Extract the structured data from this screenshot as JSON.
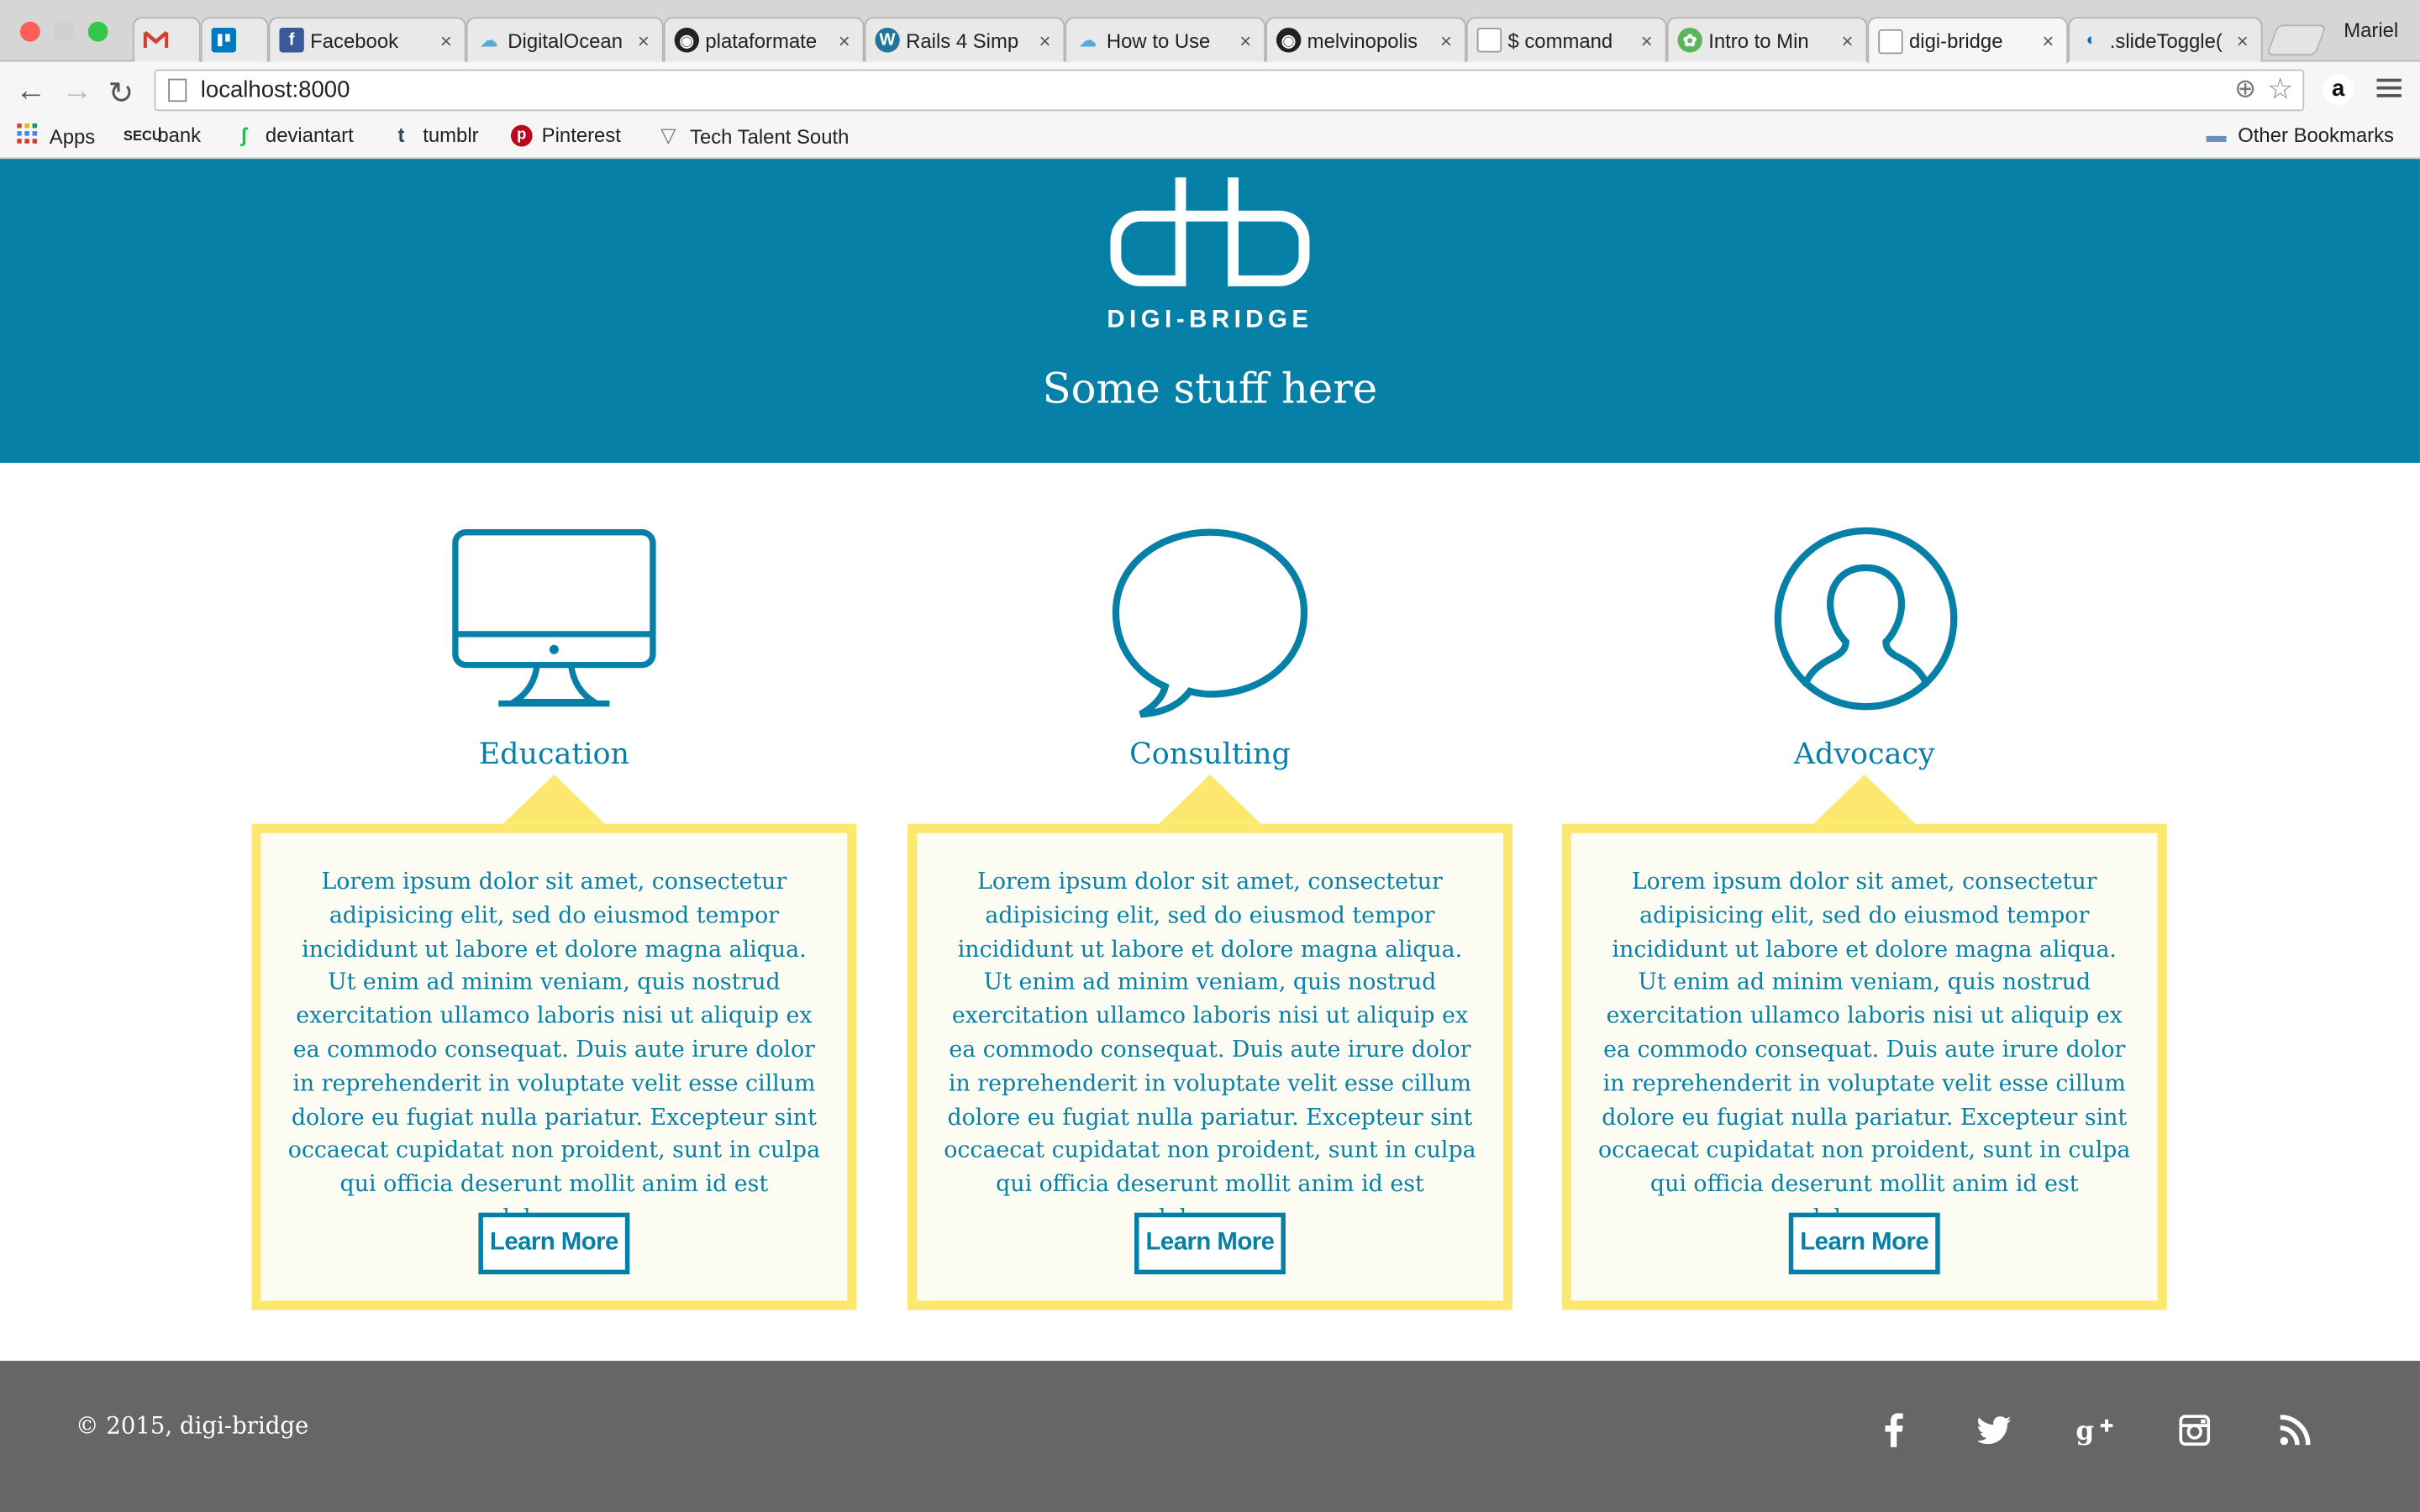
{
  "browser": {
    "profile_name": "Mariel",
    "tabs": [
      {
        "title": "",
        "icon": "gmail-icon"
      },
      {
        "title": "",
        "icon": "trello-icon"
      },
      {
        "title": "Facebook",
        "icon": "facebook-icon"
      },
      {
        "title": "DigitalOcean",
        "icon": "digitalocean-icon"
      },
      {
        "title": "plataformate",
        "icon": "github-icon"
      },
      {
        "title": "Rails 4 Simp",
        "icon": "wordpress-icon"
      },
      {
        "title": "How to Use",
        "icon": "cloud-icon"
      },
      {
        "title": "melvinopolis",
        "icon": "github-icon"
      },
      {
        "title": "$ command",
        "icon": "page-icon"
      },
      {
        "title": "Intro to Min",
        "icon": "leaf-icon"
      },
      {
        "title": "digi-bridge",
        "icon": "page-icon",
        "active": true
      },
      {
        "title": ".slideToggle(",
        "icon": "jquery-icon"
      }
    ],
    "url": "localhost:8000",
    "bookmarks": [
      {
        "label": "Apps",
        "icon": "apps-grid-icon"
      },
      {
        "label": "bank",
        "icon": "bank-icon"
      },
      {
        "label": "deviantart",
        "icon": "deviantart-icon"
      },
      {
        "label": "tumblr",
        "icon": "tumblr-icon"
      },
      {
        "label": "Pinterest",
        "icon": "pinterest-icon"
      },
      {
        "label": "Tech Talent South",
        "icon": "triangle-icon"
      }
    ],
    "other_bookmarks": "Other Bookmarks"
  },
  "hero": {
    "brand": "DIGI-BRIDGE",
    "tagline": "Some stuff here",
    "background_color": "#0780a7"
  },
  "services": [
    {
      "title": "Education",
      "icon": "monitor-icon",
      "text": "Lorem ipsum dolor sit amet, consectetur adipisicing elit, sed do eiusmod tempor incididunt ut labore et dolore magna aliqua. Ut enim ad minim veniam, quis nostrud exercitation ullamco laboris nisi ut aliquip ex ea commodo consequat. Duis aute irure dolor in reprehenderit in voluptate velit esse cillum dolore eu fugiat nulla pariatur. Excepteur sint occaecat cupidatat non proident, sunt in culpa qui officia deserunt mollit anim id est laborum.",
      "button": "Learn More"
    },
    {
      "title": "Consulting",
      "icon": "speech-bubble-icon",
      "text": "Lorem ipsum dolor sit amet, consectetur adipisicing elit, sed do eiusmod tempor incididunt ut labore et dolore magna aliqua. Ut enim ad minim veniam, quis nostrud exercitation ullamco laboris nisi ut aliquip ex ea commodo consequat. Duis aute irure dolor in reprehenderit in voluptate velit esse cillum dolore eu fugiat nulla pariatur. Excepteur sint occaecat cupidatat non proident, sunt in culpa qui officia deserunt mollit anim id est laborum.",
      "button": "Learn More"
    },
    {
      "title": "Advocacy",
      "icon": "user-profile-icon",
      "text": "Lorem ipsum dolor sit amet, consectetur adipisicing elit, sed do eiusmod tempor incididunt ut labore et dolore magna aliqua. Ut enim ad minim veniam, quis nostrud exercitation ullamco laboris nisi ut aliquip ex ea commodo consequat. Duis aute irure dolor in reprehenderit in voluptate velit esse cillum dolore eu fugiat nulla pariatur. Excepteur sint occaecat cupidatat non proident, sunt in culpa qui officia deserunt mollit anim id est laborum.",
      "button": "Learn More"
    }
  ],
  "footer": {
    "copyright": "© 2015, digi-bridge",
    "social": [
      "facebook-icon",
      "twitter-icon",
      "google-plus-icon",
      "instagram-icon",
      "rss-icon"
    ],
    "background_color": "#666666"
  },
  "colors": {
    "accent": "#0780a7",
    "card_border": "#fde86f",
    "card_bg": "#fdfcf3"
  }
}
